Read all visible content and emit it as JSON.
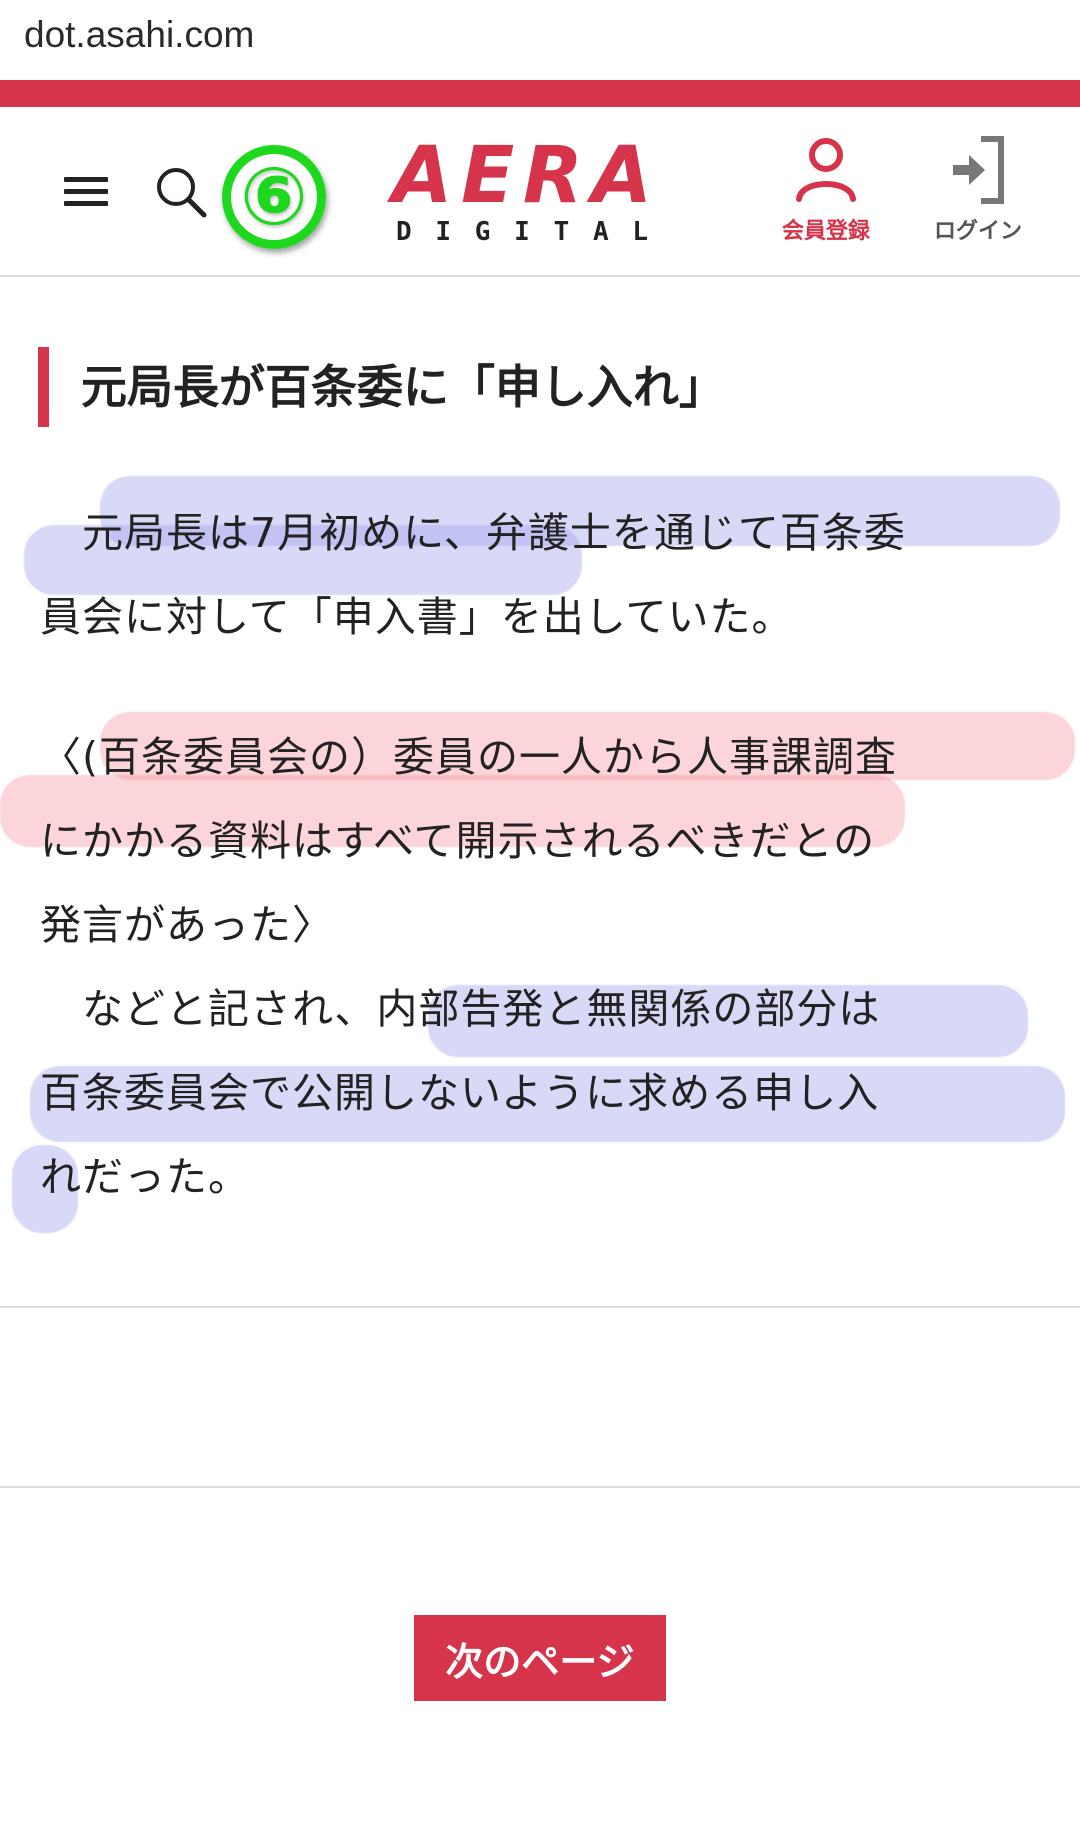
{
  "browser": {
    "url": "dot.asahi.com"
  },
  "header": {
    "badge_number": "⑥",
    "logo_main": [
      "A",
      "E",
      "R",
      "A"
    ],
    "logo_sub": [
      "D",
      "I",
      "G",
      "I",
      "T",
      "A",
      "L"
    ],
    "register_label": "会員登録",
    "login_label": "ログイン",
    "accent_color": "#d6344a"
  },
  "article": {
    "heading": "元局長が百条委に「申し入れ」",
    "lines": [
      "　元局長は7月初めに、弁護士を通じて百条委",
      "員会に対して「申入書」を出していた。",
      "〈(百条委員会の）委員の一人から人事課調査",
      "にかかる資料はすべて開示されるべきだとの",
      "発言があった〉",
      "　などと記され、内部告発と無関係の部分は",
      "百条委員会で公開しないように求める申し入",
      "れだった。"
    ]
  },
  "pagination": {
    "next_label": "次のページ"
  }
}
